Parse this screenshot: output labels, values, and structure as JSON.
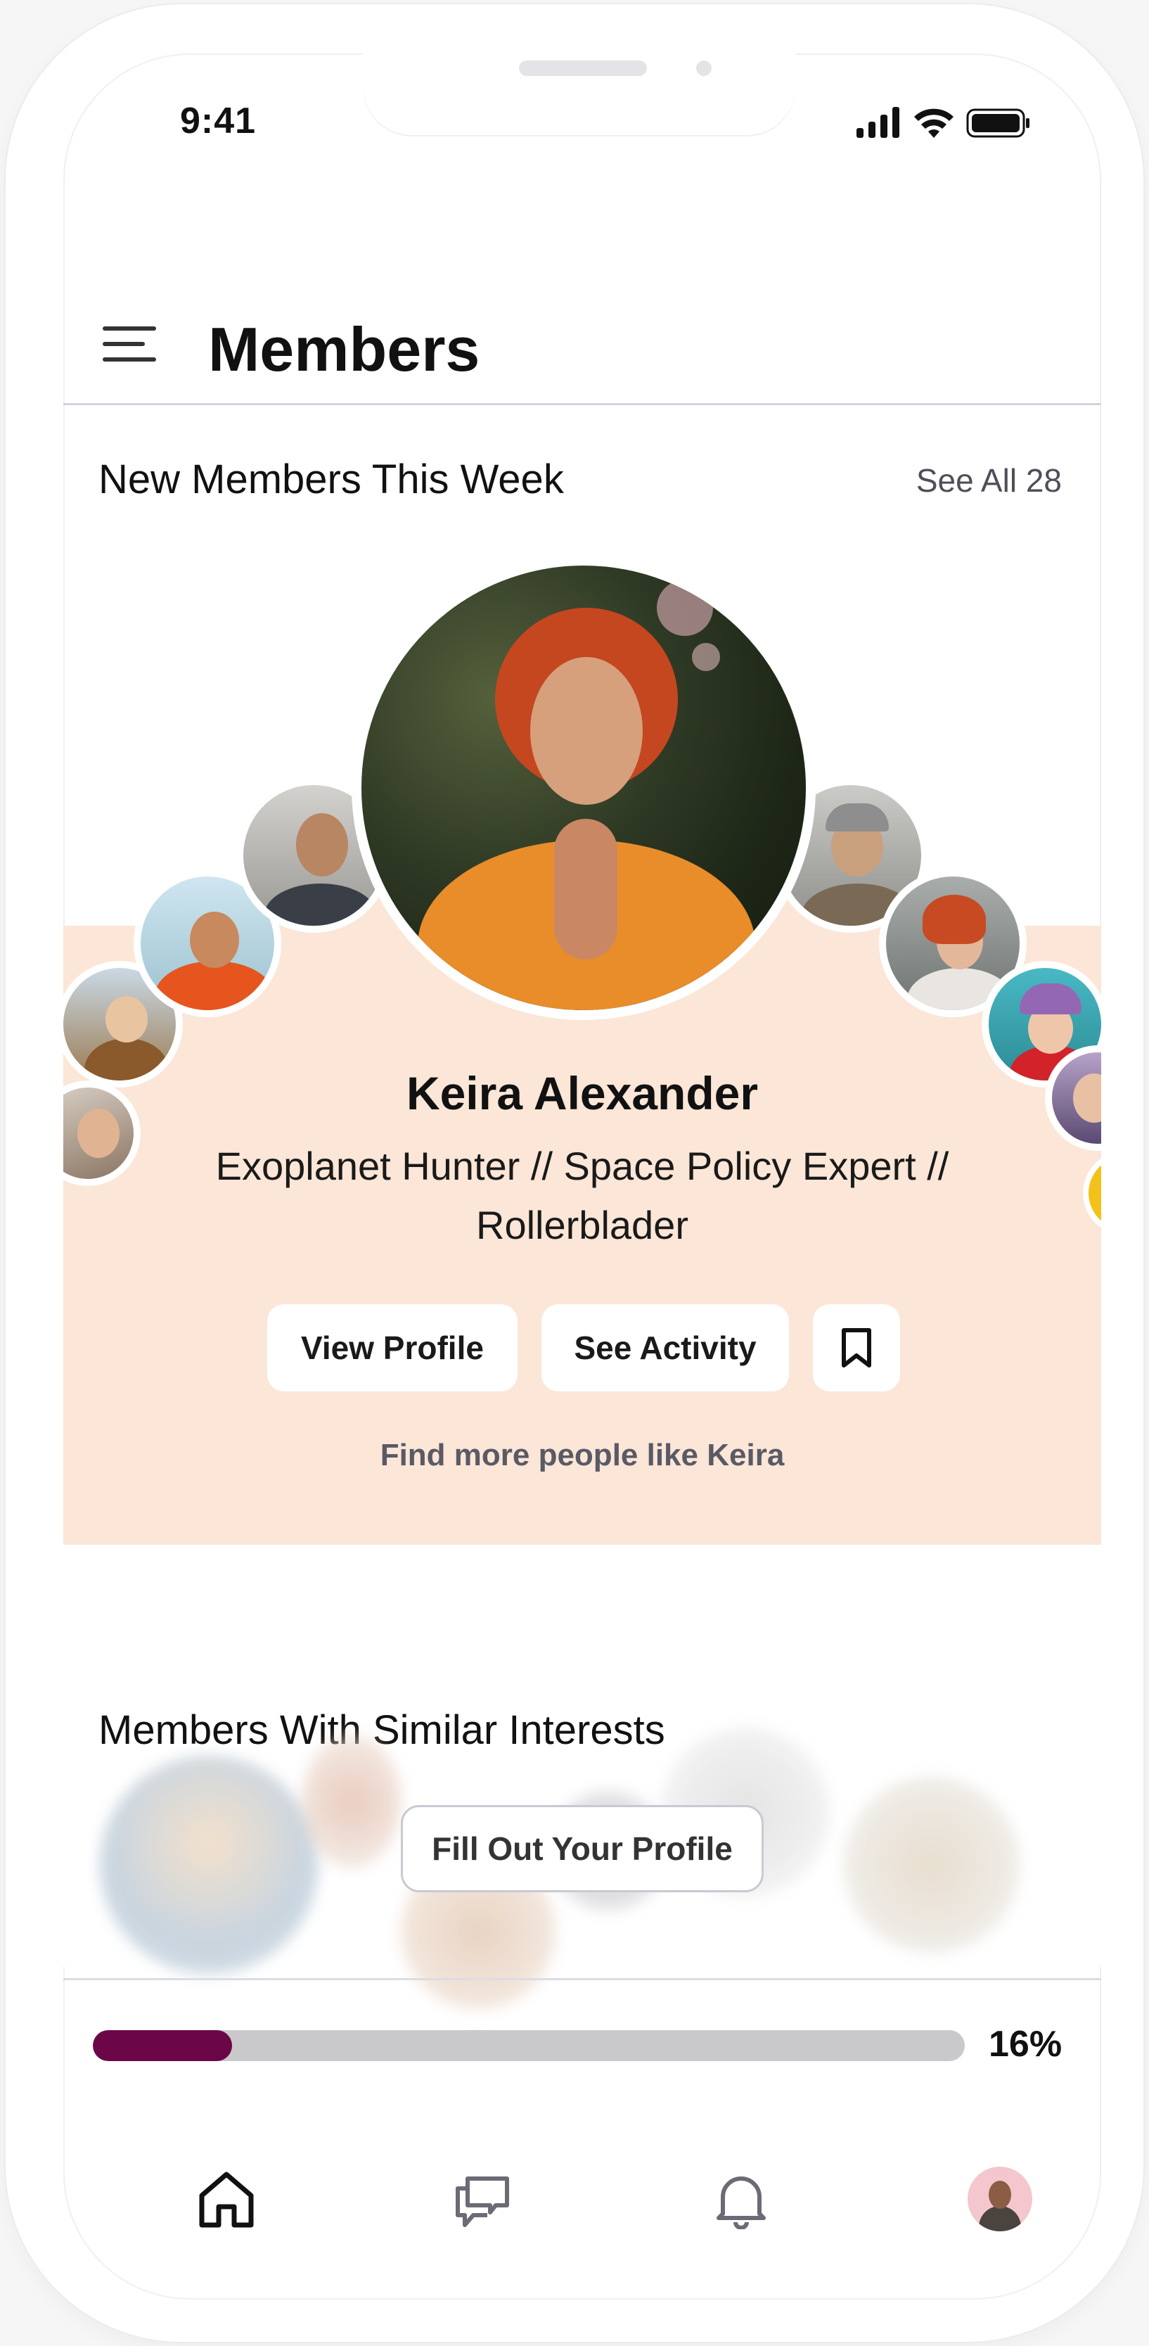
{
  "status_bar": {
    "time": "9:41"
  },
  "header": {
    "title": "Members"
  },
  "new_members": {
    "title": "New Members This Week",
    "see_all": "See All 28",
    "featured": {
      "name": "Keira Alexander",
      "bio": "Exoplanet Hunter // Space Policy Expert // Rollerblader",
      "view_profile": "View Profile",
      "see_activity": "See Activity",
      "find_more": "Find more people like Keira"
    }
  },
  "similar": {
    "title": "Members With Similar Interests",
    "cta": "Fill Out Your Profile"
  },
  "progress": {
    "value": 0.16,
    "label": "16%"
  },
  "tabbar": {
    "items": [
      {
        "icon": "home-icon"
      },
      {
        "icon": "chat-icon"
      },
      {
        "icon": "bell-icon"
      },
      {
        "icon": "profile-avatar"
      }
    ]
  },
  "colors": {
    "peach": "#fbe6d7",
    "progress_fill": "#6b0748",
    "progress_track": "#c9c9cb"
  }
}
